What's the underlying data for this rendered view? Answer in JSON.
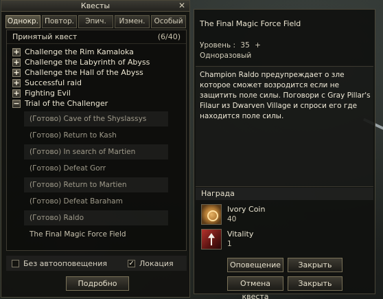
{
  "quest_window": {
    "title": "Квесты",
    "close_glyph": "✕",
    "tabs": [
      "Однокр.",
      "Повтор.",
      "Эпич.",
      "Измен.",
      "Особый"
    ],
    "panel_header": "Принятый квест",
    "panel_count": "(6/40)",
    "quests": [
      {
        "label": "Challenge the Rim Kamaloka",
        "expander": "+"
      },
      {
        "label": "Challenge the Labyrinth of Abyss",
        "expander": "+"
      },
      {
        "label": "Challenge the Hall of the Abyss",
        "expander": "+"
      },
      {
        "label": "Successful raid",
        "expander": "+"
      },
      {
        "label": "Fighting Evil",
        "expander": "+"
      },
      {
        "label": "Trial of the Challenger",
        "expander": "−"
      }
    ],
    "subquests": [
      "(Готово) Cave of the Shyslassys",
      "(Готово) Return to Kash",
      "(Готово) In search of Martien",
      "(Готово) Defeat Gorr",
      "(Готово) Return to Martien",
      "(Готово) Defeat Baraham",
      "(Готово) Raldo",
      "The Final Magic Force Field"
    ],
    "option_no_notify": "Без автооповещения",
    "option_location": "Локация",
    "location_checked_glyph": "✓",
    "details_button": "Подробно"
  },
  "detail_window": {
    "quest_title": "The Final Magic Force Field",
    "level_label": "Уровень :",
    "level_value": "35",
    "level_plus": "+",
    "repeat_type": "Одноразовый",
    "description": "Champion Raldo предупреждает о зле которое сможет возродится если не защитить поле силы. Поговори с Gray Pillar's Filaur из Dwarven Village и спроси его где находится поле силы.",
    "reward_header": "Награда",
    "rewards": [
      {
        "name": "Ivory Coin",
        "qty": "40",
        "icon": "ivory-coin-icon"
      },
      {
        "name": "Vitality",
        "qty": "1",
        "icon": "vitality-icon"
      }
    ],
    "buttons": {
      "notify": "Оповещение",
      "close_top": "Закрыть",
      "cancel_quest": "Отмена квеста",
      "close_bottom": "Закрыть"
    }
  },
  "colors": {
    "panel_bg": "#12120f",
    "border": "#4a4638",
    "text": "#ece6d2",
    "done_text": "#9f9a8a"
  }
}
